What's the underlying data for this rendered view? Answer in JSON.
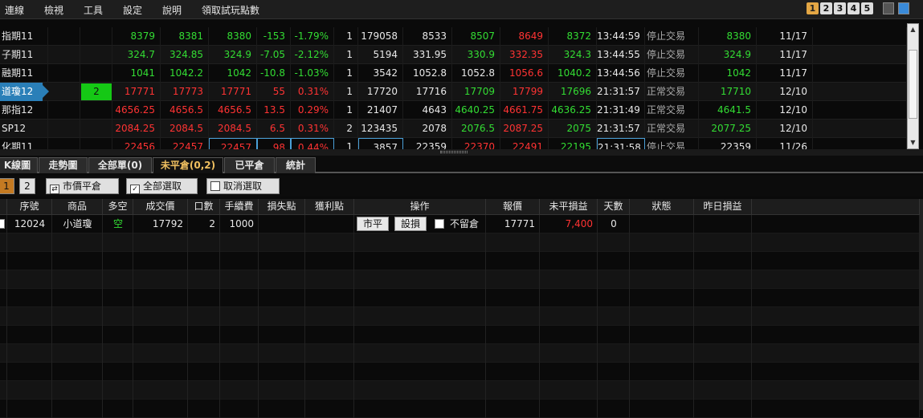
{
  "menu": [
    "連線",
    "檢視",
    "工具",
    "設定",
    "說明",
    "領取試玩點數"
  ],
  "pages": [
    "1",
    "2",
    "3",
    "4",
    "5"
  ],
  "quotes": [
    {
      "name": "指期11",
      "badge": "",
      "c1": "8379",
      "c2": "8381",
      "c3": "8380",
      "chg": "-153",
      "pct": "-1.79%",
      "qty": "1",
      "vol": "179058",
      "ref": "8533",
      "open": "8507",
      "high": "8649",
      "low": "8372",
      "time": "13:44:59",
      "status": "停止交易",
      "settle": "8380",
      "date": "11/17"
    },
    {
      "name": "子期11",
      "badge": "",
      "c1": "324.7",
      "c2": "324.85",
      "c3": "324.9",
      "chg": "-7.05",
      "pct": "-2.12%",
      "qty": "1",
      "vol": "5194",
      "ref": "331.95",
      "open": "330.9",
      "high": "332.35",
      "low": "324.3",
      "time": "13:44:55",
      "status": "停止交易",
      "settle": "324.9",
      "date": "11/17"
    },
    {
      "name": "融期11",
      "badge": "",
      "c1": "1041",
      "c2": "1042.2",
      "c3": "1042",
      "chg": "-10.8",
      "pct": "-1.03%",
      "qty": "1",
      "vol": "3542",
      "ref": "1052.8",
      "open": "1052.8",
      "high": "1056.6",
      "low": "1040.2",
      "time": "13:44:56",
      "status": "停止交易",
      "settle": "1042",
      "date": "11/17"
    },
    {
      "name": "道瓊12",
      "badge": "2",
      "c1": "17771",
      "c2": "17773",
      "c3": "17771",
      "chg": "55",
      "pct": "0.31%",
      "qty": "1",
      "vol": "17720",
      "ref": "17716",
      "open": "17709",
      "high": "17799",
      "low": "17696",
      "time": "21:31:57",
      "status": "正常交易",
      "settle": "17710",
      "date": "12/10"
    },
    {
      "name": "那指12",
      "badge": "",
      "c1": "4656.25",
      "c2": "4656.5",
      "c3": "4656.5",
      "chg": "13.5",
      "pct": "0.29%",
      "qty": "1",
      "vol": "21407",
      "ref": "4643",
      "open": "4640.25",
      "high": "4661.75",
      "low": "4636.25",
      "time": "21:31:49",
      "status": "正常交易",
      "settle": "4641.5",
      "date": "12/10"
    },
    {
      "name": "SP12",
      "badge": "",
      "c1": "2084.25",
      "c2": "2084.5",
      "c3": "2084.5",
      "chg": "6.5",
      "pct": "0.31%",
      "qty": "2",
      "vol": "123435",
      "ref": "2078",
      "open": "2076.5",
      "high": "2087.25",
      "low": "2075",
      "time": "21:31:57",
      "status": "正常交易",
      "settle": "2077.25",
      "date": "12/10"
    },
    {
      "name": "化期11",
      "badge": "",
      "c1": "22456",
      "c2": "22457",
      "c3": "22457",
      "chg": "98",
      "pct": "0.44%",
      "qty": "1",
      "vol": "3857",
      "ref": "22359",
      "open": "22370",
      "high": "22491",
      "low": "22195",
      "time": "21:31:58",
      "status": "停止交易",
      "settle": "22359",
      "date": "11/26"
    }
  ],
  "tabs": [
    "K線圖",
    "走勢圖",
    "全部單(0)",
    "未平倉(0,2)",
    "已平倉",
    "統計"
  ],
  "toolbar": {
    "num1": "1",
    "num2": "2",
    "market_close": "市價平倉",
    "select_all": "全部選取",
    "deselect": "取消選取"
  },
  "columns": [
    "序號",
    "商品",
    "多空",
    "成交價",
    "口數",
    "手續費",
    "損失點",
    "獲利點",
    "操作",
    "報價",
    "未平損益",
    "天數",
    "狀態",
    "昨日損益"
  ],
  "positions": [
    {
      "seq": "12024",
      "product": "小道瓊",
      "side": "空",
      "price": "17792",
      "lots": "2",
      "fee": "1000",
      "stop_loss": "",
      "take_profit": "",
      "btn_close": "市平",
      "btn_set": "設損",
      "keep_label": "不留倉",
      "quote": "17771",
      "pnl": "7,400",
      "days": "0",
      "status": "",
      "yesterday": ""
    }
  ],
  "colors": {
    "up": "#ff3333",
    "down": "#33dd33",
    "accent": "#f0c060",
    "selected": "#2a7fb8",
    "badge": "#15c815"
  }
}
